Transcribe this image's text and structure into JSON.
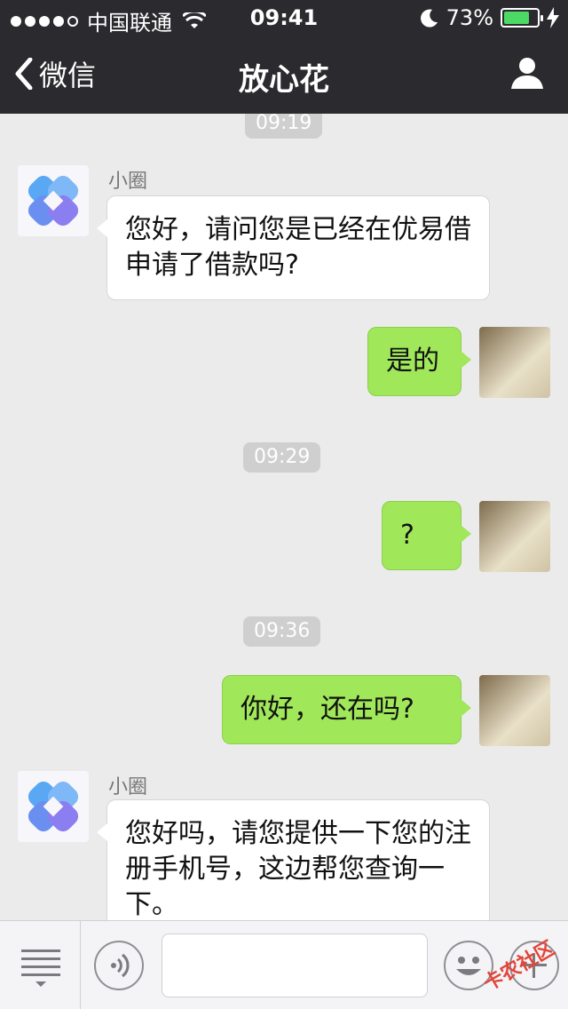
{
  "status_bar": {
    "carrier": "中国联通",
    "time": "09:41",
    "battery": "73%"
  },
  "nav": {
    "back_label": "微信",
    "title": "放心花"
  },
  "chat": {
    "timestamps": [
      "09:19",
      "09:29",
      "09:36"
    ],
    "sender_name": "小圈",
    "messages": [
      {
        "side": "left",
        "text": "您好，请问您是已经在优易借申请了借款吗?"
      },
      {
        "side": "right",
        "text": "是的"
      },
      {
        "side": "right",
        "text": "?"
      },
      {
        "side": "right",
        "text": "你好，还在吗?"
      },
      {
        "side": "left",
        "text": "您好吗，请您提供一下您的注册手机号，这边帮您查询一下。"
      }
    ]
  },
  "input_bar": {
    "input_value": ""
  },
  "watermark": "卡农社区"
}
